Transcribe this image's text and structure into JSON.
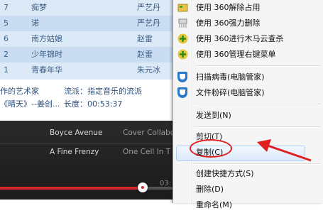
{
  "playlist": {
    "rows": [
      {
        "num": "7",
        "title": "痴梦",
        "artist": "严艺丹"
      },
      {
        "num": "5",
        "title": "诺",
        "artist": "严艺丹"
      },
      {
        "num": "6",
        "title": "南方姑娘",
        "artist": "赵雷"
      },
      {
        "num": "2",
        "title": "少年锦时",
        "artist": "赵雷"
      },
      {
        "num": "1",
        "title": "青春年华",
        "artist": "朱元冰"
      }
    ],
    "info": {
      "artist_line": "作的艺术家",
      "genre_line": "流派：指定音乐的流派",
      "album_line": "《晴天》--姜创...",
      "length_line": "长度：00:53:37"
    }
  },
  "player": {
    "tracks": [
      {
        "artist": "Boyce Avenue",
        "title": "Cover Collabo"
      },
      {
        "artist": "A Fine Frenzy",
        "title": "One Cell In T"
      }
    ],
    "progress": 0.81,
    "time": "03:"
  },
  "menu": {
    "items": [
      {
        "label": "使用 360解除占用"
      },
      {
        "label": "使用 360强力删除"
      },
      {
        "label": "使用 360进行木马云查杀"
      },
      {
        "label": "使用 360管理右键菜单"
      },
      {
        "label": "扫描病毒(电脑管家)"
      },
      {
        "label": "文件粉碎(电脑管家)"
      },
      {
        "label": "发送到(N)"
      },
      {
        "label": "剪切(T)"
      },
      {
        "label": "复制(C)"
      },
      {
        "label": "创建快捷方式(S)"
      },
      {
        "label": "删除(D)"
      },
      {
        "label": "重命名(M)"
      }
    ]
  },
  "colors": {
    "accent_red": "#e02020",
    "shield_blue": "#2a78c8",
    "green_plus": "#3aa82a"
  }
}
